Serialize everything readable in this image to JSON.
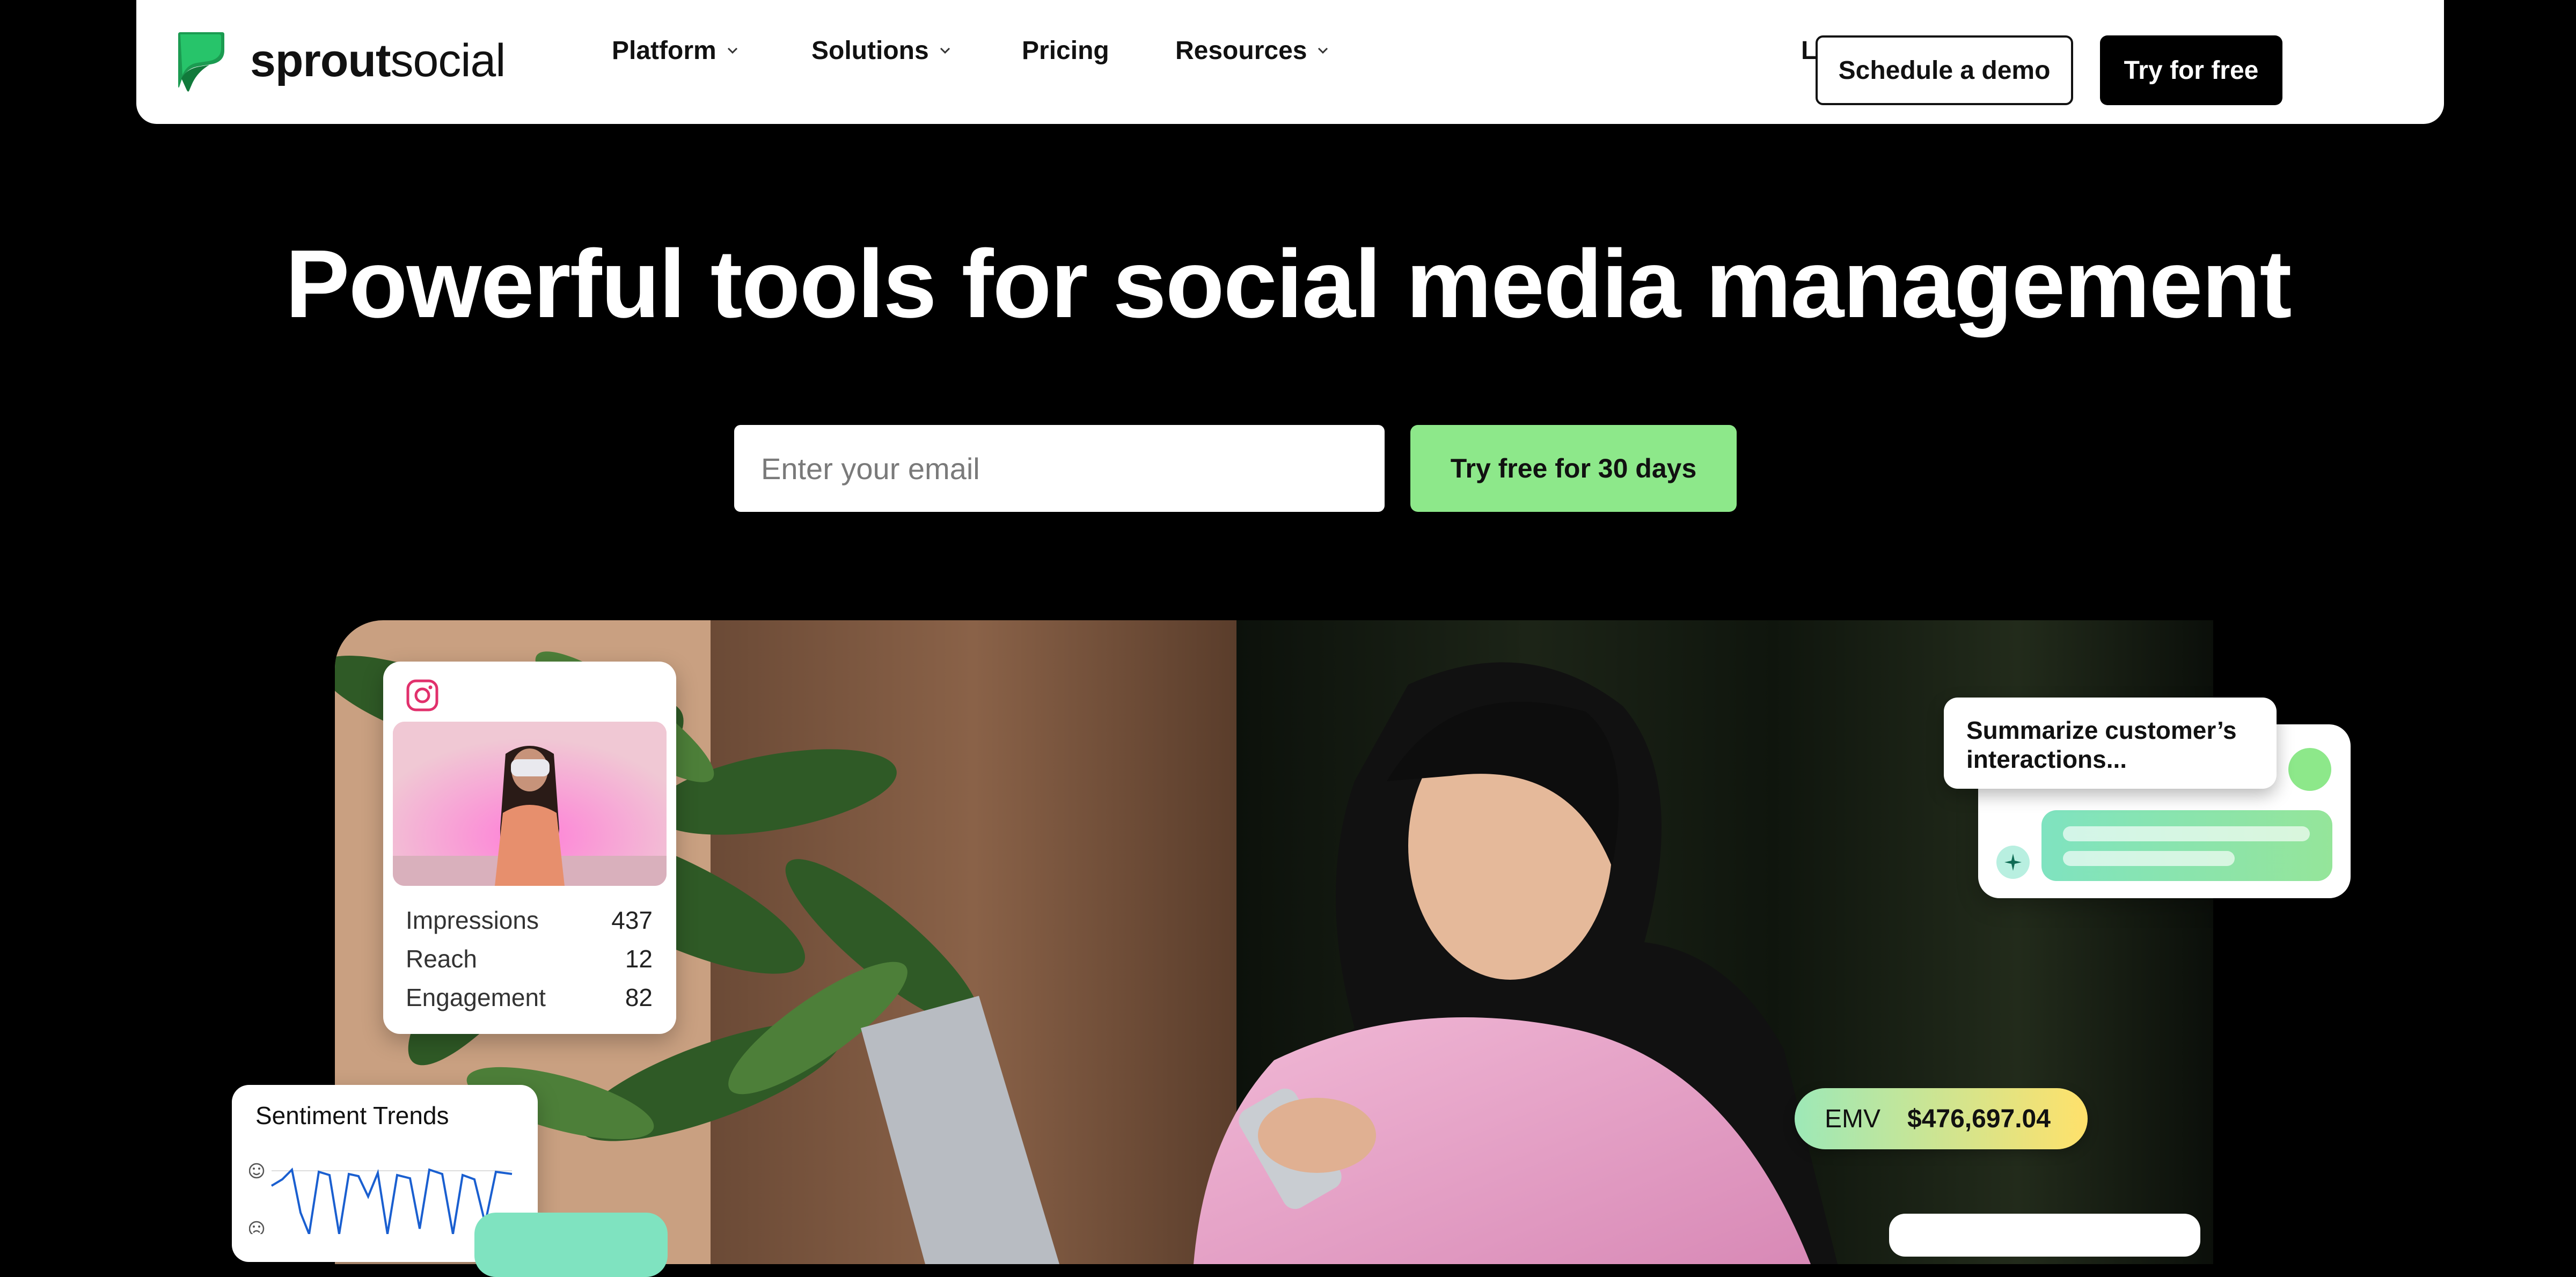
{
  "brand": {
    "name_bold": "sprout",
    "name_light": "social"
  },
  "nav": {
    "items": [
      {
        "label": "Platform",
        "dropdown": true
      },
      {
        "label": "Solutions",
        "dropdown": true
      },
      {
        "label": "Pricing",
        "dropdown": false
      },
      {
        "label": "Resources",
        "dropdown": true
      }
    ],
    "login": "Log in",
    "schedule_demo": "Schedule a demo",
    "try_free": "Try for free"
  },
  "hero": {
    "title": "Powerful tools for social media management",
    "email_placeholder": "Enter your email",
    "cta": "Try free for 30 days"
  },
  "instagram_card": {
    "icon": "instagram-icon",
    "stats": [
      {
        "label": "Impressions",
        "value": "437"
      },
      {
        "label": "Reach",
        "value": "12"
      },
      {
        "label": "Engagement",
        "value": "82"
      }
    ]
  },
  "sentiment_card": {
    "title": "Sentiment Trends"
  },
  "ai_card": {
    "prompt": "Summarize customer’s interactions..."
  },
  "emv_badge": {
    "label": "EMV",
    "value": "$476,697.04"
  },
  "colors": {
    "accent_green": "#8de88a",
    "brand_green": "#1fa25a",
    "instagram": "#e1306c"
  }
}
